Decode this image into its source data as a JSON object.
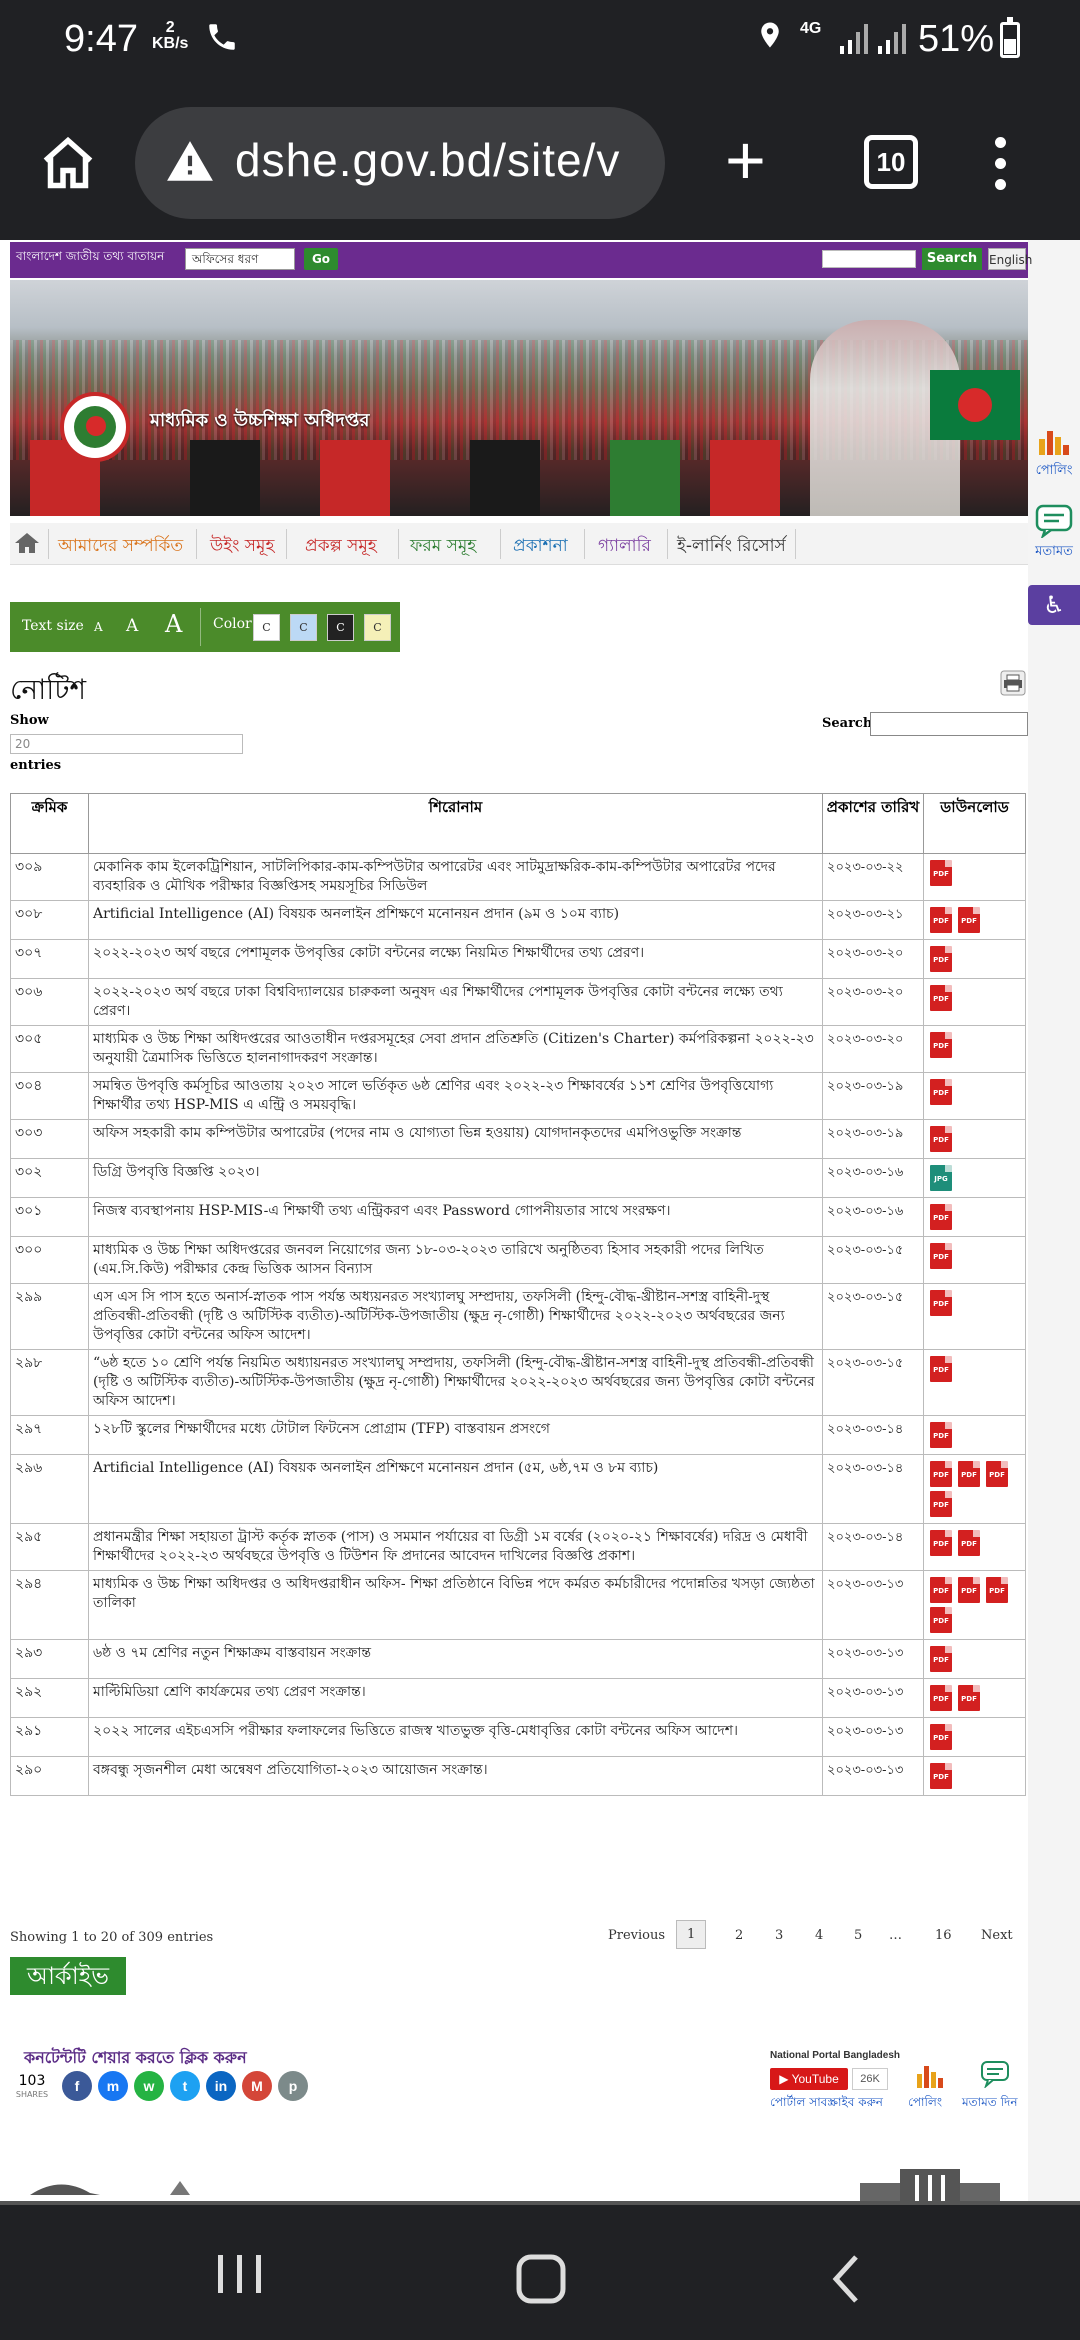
{
  "status": {
    "time": "9:47",
    "speed_value": "2",
    "speed_unit": "KB/s",
    "network": "4G",
    "battery": "51%",
    "battery_level": 0.51
  },
  "browser": {
    "url": "dshe.gov.bd/site/v",
    "tab_count": "10"
  },
  "topbar": {
    "portal_label": "বাংলাদেশ জাতীয় তথ্য বাতায়ন",
    "office_select": "অফিসের ধরণ",
    "go_label": "Go",
    "search_label": "Search",
    "english_label": "English"
  },
  "banner": {
    "title": "মাধ্যমিক ও উচ্চশিক্ষা অধিদপ্তর"
  },
  "nav": {
    "items": [
      {
        "label": "আমাদের সম্পর্কিত",
        "color": "#d9731b"
      },
      {
        "label": "উইং সমূহ",
        "color": "#c62828"
      },
      {
        "label": "প্রকল্প সমূহ",
        "color": "#c62828"
      },
      {
        "label": "ফরম সমূহ",
        "color": "#2e7d32"
      },
      {
        "label": "প্রকাশনা",
        "color": "#1a6fb3"
      },
      {
        "label": "গ্যালারি",
        "color": "#7b3fa0"
      },
      {
        "label": "ই-লার্নিং রিসোর্স",
        "color": "#333333"
      }
    ]
  },
  "accessibility": {
    "text_size_label": "Text size",
    "a_small": "A",
    "a_medium": "A",
    "a_large": "A",
    "color_label": "Color",
    "swatch_label": "C"
  },
  "sidebar": {
    "poll": "পোলিং",
    "feedback": "মতামত"
  },
  "notice": {
    "title": "নোটিশ",
    "show_label": "Show",
    "show_value": "20",
    "entries_label": "entries",
    "search_label": "Search:"
  },
  "table": {
    "headers": {
      "sl": "ক্রমিক",
      "title": "শিরোনাম",
      "date": "প্রকাশের তারিখ",
      "download": "ডাউনলোড"
    },
    "rows": [
      {
        "sl": "৩০৯",
        "title": "মেকানিক কাম ইলেকট্রিশিয়ান, সাটলিপিকার-কাম-কম্পিউটার অপারেটর এবং সাটমুদ্রাক্ষরিক-কাম-কম্পিউটার অপারেটর পদের ব্যবহারিক ও মৌখিক পরীক্ষার বিজ্ঞপ্তিসহ সময়সূচির সিডিউল",
        "date": "২০২৩-০৩-২২",
        "files": [
          "PDF"
        ]
      },
      {
        "sl": "৩০৮",
        "title": "Artificial Intelligence (AI) বিষয়ক অনলাইন প্রশিক্ষণে মনোনয়ন প্রদান (৯ম ও ১০ম ব্যাচ)",
        "date": "২০২৩-০৩-২১",
        "files": [
          "PDF",
          "PDF"
        ]
      },
      {
        "sl": "৩০৭",
        "title": "২০২২-২০২৩ অর্থ বছরে পেশামূলক উপবৃত্তির কোটা বন্টনের লক্ষ্যে নিয়মিত শিক্ষার্থীদের তথ্য প্রেরণ।",
        "date": "২০২৩-০৩-২০",
        "files": [
          "PDF"
        ]
      },
      {
        "sl": "৩০৬",
        "title": "২০২২-২০২৩ অর্থ বছরে ঢাকা বিশ্ববিদ্যালয়ের চারুকলা অনুষদ এর শিক্ষার্থীদের পেশামূলক উপবৃত্তির কোটা বন্টনের লক্ষ্যে তথ্য প্রেরণ।",
        "date": "২০২৩-০৩-২০",
        "files": [
          "PDF"
        ]
      },
      {
        "sl": "৩০৫",
        "title": "মাধ্যমিক ও উচ্চ শিক্ষা অধিদপ্তরের আওতাধীন দপ্তরসমূহের সেবা প্রদান প্রতিশ্রুতি (Citizen's Charter) কর্মপরিকল্পনা ২০২২-২৩ অনুযায়ী ত্রৈমাসিক ভিত্তিতে হালনাগাদকরণ সংক্রান্ত।",
        "date": "২০২৩-০৩-২০",
        "files": [
          "PDF"
        ]
      },
      {
        "sl": "৩০৪",
        "title": "সমন্বিত উপবৃত্তি কর্মসূচির আওতায় ২০২৩ সালে ভর্তিকৃত ৬ষ্ঠ শ্রেণির এবং ২০২২-২৩ শিক্ষাবর্ষের ১১শ শ্রেণির উপবৃত্তিযোগ্য শিক্ষার্থীর তথ্য HSP-MIS এ এন্ট্রি ও সময়বৃদ্ধি।",
        "date": "২০২৩-০৩-১৯",
        "files": [
          "PDF"
        ]
      },
      {
        "sl": "৩০৩",
        "title": "অফিস সহকারী কাম কম্পিউটার অপারেটর (পদের নাম ও যোগ্যতা ভিন্ন হওয়ায়) যোগদানকৃতদের এমপিওভুক্তি সংক্রান্ত",
        "date": "২০২৩-০৩-১৯",
        "files": [
          "PDF"
        ]
      },
      {
        "sl": "৩০২",
        "title": "ডিগ্রি উপবৃত্তি বিজ্ঞপ্তি ২০২৩।",
        "date": "২০২৩-০৩-১৬",
        "files": [
          "JPG"
        ]
      },
      {
        "sl": "৩০১",
        "title": "নিজস্ব ব্যবস্থাপনায় HSP-MIS-এ শিক্ষার্থী তথ্য এন্ট্রিকরণ এবং Password গোপনীয়তার সাথে সংরক্ষণ।",
        "date": "২০২৩-০৩-১৬",
        "files": [
          "PDF"
        ]
      },
      {
        "sl": "৩০০",
        "title": "মাধ্যমিক ও উচ্চ শিক্ষা অধিদপ্তরের জনবল নিয়োগের জন্য ১৮-০৩-২০২৩ তারিখে অনুষ্ঠিতব্য হিসাব সহকারী পদের লিখিত (এম.সি.কিউ) পরীক্ষার কেন্দ্র ভিত্তিক আসন বিন্যাস",
        "date": "২০২৩-০৩-১৫",
        "files": [
          "PDF"
        ]
      },
      {
        "sl": "২৯৯",
        "title": "এস এস সি পাস হতে অনার্স-স্নাতক পাস পর্যন্ত অধ্যয়নরত সংখ্যালঘু সম্প্রদায়, তফসিলী (হিন্দু-বৌদ্ধ-খ্রীষ্টান-সশস্ত্র বাহিনী-দুস্থ প্রতিবন্ধী-প্রতিবন্ধী (দৃষ্টি ও অটিস্টিক ব্যতীত)-অটিস্টিক-উপজাতীয় (ক্ষুদ্র নৃ-গোষ্ঠী) শিক্ষার্থীদের ২০২২-২০২৩ অর্থবছরের জন্য উপবৃত্তির কোটা বন্টনের অফিস আদেশ।",
        "date": "২০২৩-০৩-১৫",
        "files": [
          "PDF"
        ]
      },
      {
        "sl": "২৯৮",
        "title": "“৬ষ্ঠ হতে ১০ শ্রেণি পর্যন্ত নিয়মিত অধ্যায়নরত সংখ্যালঘু সম্প্রদায়, তফসিলী (হিন্দু-বৌদ্ধ-খ্রীষ্টান-সশস্ত্র বাহিনী-দুস্থ প্রতিবন্ধী-প্রতিবন্ধী (দৃষ্টি ও অটিস্টিক ব্যতীত)-অটিস্টিক-উপজাতীয় (ক্ষুদ্র নৃ-গোষ্ঠী) শিক্ষার্থীদের ২০২২-২০২৩ অর্থবছরের জন্য উপবৃত্তির কোটা বন্টনের অফিস আদেশ।",
        "date": "২০২৩-০৩-১৫",
        "files": [
          "PDF"
        ]
      },
      {
        "sl": "২৯৭",
        "title": "১২৮টি স্কুলের শিক্ষার্থীদের মধ্যে টোটাল ফিটনেস প্রোগ্রাম (TFP) বাস্তবায়ন প্রসংগে",
        "date": "২০২৩-০৩-১৪",
        "files": [
          "PDF"
        ]
      },
      {
        "sl": "২৯৬",
        "title": "Artificial Intelligence (AI) বিষয়ক অনলাইন প্রশিক্ষণে মনোনয়ন প্রদান (৫ম, ৬ষ্ঠ,৭ম ও ৮ম ব্যাচ)",
        "date": "২০২৩-০৩-১৪",
        "files": [
          "PDF",
          "PDF",
          "PDF",
          "PDF"
        ]
      },
      {
        "sl": "২৯৫",
        "title": "প্রধানমন্ত্রীর শিক্ষা সহায়তা ট্রাস্ট কর্তৃক স্নাতক (পাস) ও সমমান পর্যায়ের বা ডিগ্রী ১ম বর্ষের (২০২০-২১ শিক্ষাবর্ষের) দরিদ্র ও মেধাবী শিক্ষার্থীদের ২০২২-২৩ অর্থবছরে উপবৃত্তি ও টিউশন ফি প্রদানের আবেদন দাখিলের বিজ্ঞপ্তি প্রকাশ।",
        "date": "২০২৩-০৩-১৪",
        "files": [
          "PDF",
          "PDF"
        ]
      },
      {
        "sl": "২৯৪",
        "title": "মাধ্যমিক ও উচ্চ শিক্ষা অধিদপ্তর ও অধিদপ্তরাধীন অফিস- শিক্ষা প্রতিষ্ঠানে বিভিন্ন পদে কর্মরত কর্মচারীদের পদোন্নতির খসড়া জ্যেষ্ঠতা তালিকা",
        "date": "২০২৩-০৩-১৩",
        "files": [
          "PDF",
          "PDF",
          "PDF",
          "PDF"
        ]
      },
      {
        "sl": "২৯৩",
        "title": "৬ষ্ঠ ও ৭ম শ্রেণির নতুন শিক্ষাক্রম বাস্তবায়ন সংক্রান্ত",
        "date": "২০২৩-০৩-১৩",
        "files": [
          "PDF"
        ]
      },
      {
        "sl": "২৯২",
        "title": "মাল্টিমিডিয়া শ্রেণি কার্যক্রমের তথ্য প্রেরণ সংক্রান্ত।",
        "date": "২০২৩-০৩-১৩",
        "files": [
          "PDF",
          "PDF"
        ]
      },
      {
        "sl": "২৯১",
        "title": "২০২২ সালের এইচএসসি পরীক্ষার ফলাফলের ভিত্তিতে রাজস্ব খাতভুক্ত বৃত্তি-মেধাবৃত্তির কোটা বন্টনের অফিস আদেশ।",
        "date": "২০২৩-০৩-১৩",
        "files": [
          "PDF"
        ]
      },
      {
        "sl": "২৯০",
        "title": "বঙ্গবন্ধু সৃজনশীল মেধা অন্বেষণ প্রতিযোগিতা-২০২৩ আয়োজন সংক্রান্ত।",
        "date": "২০২৩-০৩-১৩",
        "files": [
          "PDF"
        ]
      }
    ]
  },
  "pagination": {
    "summary": "Showing 1 to 20 of 309 entries",
    "previous": "Previous",
    "pages": [
      "1",
      "2",
      "3",
      "4",
      "5",
      "…",
      "16"
    ],
    "next": "Next"
  },
  "archive_label": "আর্কাইভ",
  "share": {
    "title": "কনটেন্টটি শেয়ার করতে ক্লিক করুন",
    "count": "103",
    "count_label": "SHARES",
    "buttons": [
      {
        "name": "facebook",
        "glyph": "f",
        "color": "#3b5998"
      },
      {
        "name": "messenger",
        "glyph": "m",
        "color": "#1877f2"
      },
      {
        "name": "whatsapp",
        "glyph": "w",
        "color": "#25b343"
      },
      {
        "name": "twitter",
        "glyph": "t",
        "color": "#1da1f2"
      },
      {
        "name": "linkedin",
        "glyph": "in",
        "color": "#0a66c2"
      },
      {
        "name": "gmail",
        "glyph": "M",
        "color": "#d44638"
      },
      {
        "name": "print",
        "glyph": "p",
        "color": "#7c8a8a"
      }
    ]
  },
  "portal": {
    "title": "National Portal Bangladesh",
    "youtube": "YouTube",
    "youtube_count": "26K",
    "subscribe": "পোর্টাল সাবস্ক্রাইব করুন",
    "poll": "পোলিং",
    "feedback": "মতামত দিন"
  }
}
